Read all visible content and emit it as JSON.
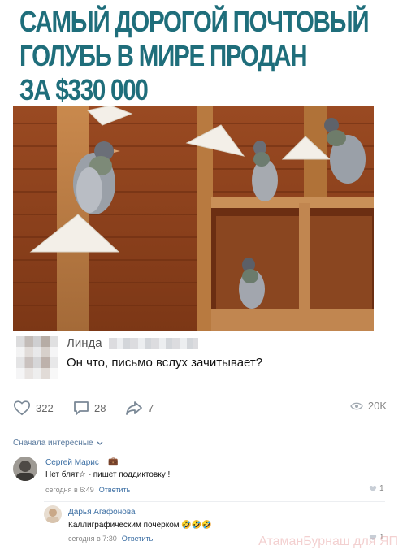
{
  "headline": {
    "lines": [
      "САМЫЙ ДОРОГОЙ ПОЧТОВЫЙ",
      "ГОЛУБЬ В МИРЕ ПРОДАН",
      "ЗА $330 000"
    ],
    "color": "#1f6e7b"
  },
  "photo": {
    "description_icon": "pigeons-photo"
  },
  "caption": {
    "author_first_name": "Линда",
    "text": "Он что, письмо вслух зачитывает?"
  },
  "actions": {
    "likes": "322",
    "comments": "28",
    "shares": "7",
    "views": "20K",
    "icons": [
      "heart-icon",
      "comment-icon",
      "share-icon",
      "eye-icon"
    ]
  },
  "comments_section": {
    "sort_label": "Сначала интересные",
    "comments": [
      {
        "author": "Сергей Марис",
        "text": "Нет блят☆ - пишет поддиктовку !",
        "time": "сегодня в 6:49",
        "reply_label": "Ответить",
        "likes": "1"
      },
      {
        "author": "Дарья Агафонова",
        "text": "Каллиграфическим почерком 🤣🤣🤣",
        "time": "сегодня в 7:30",
        "reply_label": "Ответить",
        "likes": "1"
      }
    ]
  },
  "watermark": "АтаманБурнаш для ЯП",
  "colors": {
    "link": "#3b6ea3",
    "muted": "#888888",
    "divider": "#e7e8ec"
  }
}
